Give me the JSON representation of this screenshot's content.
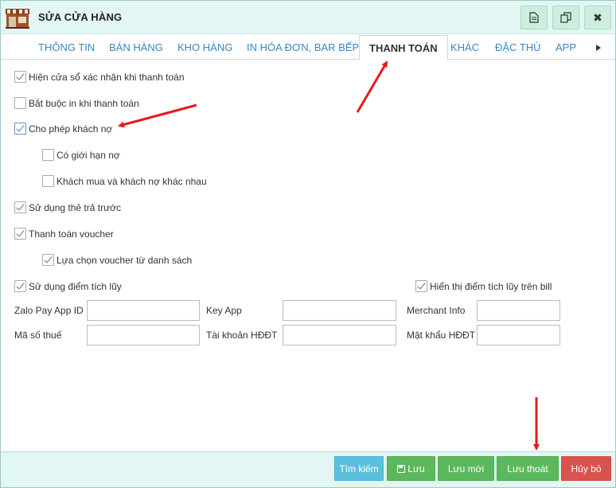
{
  "window": {
    "title": "SỬA CỬA HÀNG",
    "toolbar_icons": [
      "document-icon",
      "copy-icon",
      "close-icon"
    ]
  },
  "tabs": [
    {
      "label": "THÔNG TIN"
    },
    {
      "label": "BÁN HÀNG"
    },
    {
      "label": "KHO HÀNG"
    },
    {
      "label": "IN HÓA ĐƠN, BAR BẾP"
    },
    {
      "label": "THANH TOÁN"
    },
    {
      "label": "KHÁC"
    },
    {
      "label": "ĐẶC THÙ"
    },
    {
      "label": "APP"
    }
  ],
  "active_tab": "THANH TOÁN",
  "options": {
    "show_confirm": {
      "label": "Hiện cửa sổ xác nhận khi thanh toán",
      "checked": true
    },
    "require_print": {
      "label": "Bắt buộc in khi thanh toán",
      "checked": false
    },
    "allow_debt": {
      "label": "Cho phép khách nợ",
      "checked": true
    },
    "debt_limit": {
      "label": "Có giới hạn nợ",
      "checked": false
    },
    "buyer_debtor_diff": {
      "label": "Khách mua và khách nợ khác nhau",
      "checked": false
    },
    "prepaid_card": {
      "label": "Sử dụng thẻ trả trước",
      "checked": true
    },
    "voucher": {
      "label": "Thanh toán voucher",
      "checked": true
    },
    "voucher_from_list": {
      "label": "Lựa chọn voucher từ danh sách",
      "checked": true
    },
    "loyalty_points": {
      "label": "Sử dụng điểm tích lũy",
      "checked": true
    },
    "show_points_on_bill": {
      "label": "Hiển thị điểm tích lũy trên bill",
      "checked": true
    }
  },
  "fields": {
    "zalo_app_id": {
      "label": "Zalo Pay App ID",
      "value": ""
    },
    "key_app": {
      "label": "Key App",
      "value": ""
    },
    "merchant_info": {
      "label": "Merchant Info",
      "value": ""
    },
    "tax_code": {
      "label": "Mã số thuế",
      "value": ""
    },
    "einvoice_account": {
      "label": "Tài  khoản HĐĐT",
      "value": ""
    },
    "einvoice_password": {
      "label": "Mật khẩu HĐĐT",
      "value": ""
    }
  },
  "footer": {
    "search": "Tìm kiếm",
    "save": "Lưu",
    "save_new": "Lưu mới",
    "save_exit": "Lưu thoát",
    "cancel": "Hủy bỏ"
  },
  "colors": {
    "titlebar_bg": "#e2f6f3",
    "tab_link": "#3a86c5",
    "btn_info": "#5bc0de",
    "btn_success": "#5cb85c",
    "btn_danger": "#d9534f",
    "annotation_arrow": "#e8191b"
  }
}
